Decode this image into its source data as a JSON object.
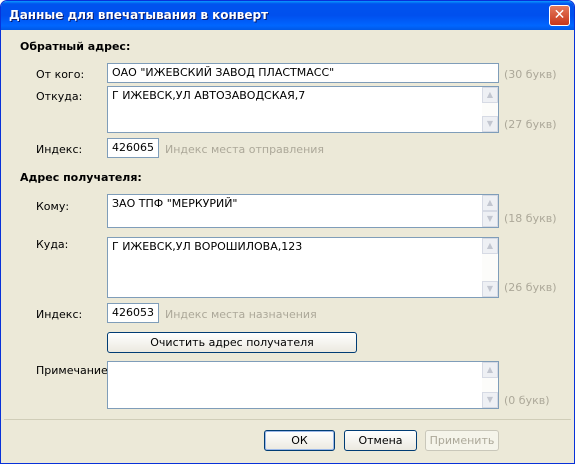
{
  "window": {
    "title": "Данные для впечатывания в конверт",
    "close_glyph": "✕"
  },
  "sender": {
    "section_title": "Обратный адрес:",
    "from_label": "От кого:",
    "from_value": "ОАО \"ИЖЕВСКИЙ ЗАВОД ПЛАСТМАСС\"",
    "from_count": "(30 букв)",
    "where_label": "Откуда:",
    "where_value": "Г ИЖЕВСК,УЛ АВТОЗАВОДСКАЯ,7",
    "where_count": "(27 букв)",
    "index_label": "Индекс:",
    "index_value": "426065",
    "index_hint": "Индекс места отправления"
  },
  "recipient": {
    "section_title": "Адрес получателя:",
    "to_label": "Кому:",
    "to_value": "ЗАО ТПФ \"МЕРКУРИЙ\"",
    "to_count": "(18 букв)",
    "where_label": "Куда:",
    "where_value": "Г ИЖЕВСК,УЛ ВОРОШИЛОВА,123",
    "where_count": "(26 букв)",
    "index_label": "Индекс:",
    "index_value": "426053",
    "index_hint": "Индекс места назначения",
    "clear_button": "Очистить адрес получателя"
  },
  "note": {
    "label": "Примечание:",
    "value": "",
    "count": "(0 букв)"
  },
  "footer": {
    "ok": "ОК",
    "cancel": "Отмена",
    "apply": "Применить"
  },
  "icons": {
    "scroll_up": "▲",
    "scroll_down": "▼"
  },
  "colors": {
    "title_bar": "#0054e3",
    "dialog_bg": "#ece9d8",
    "hint_text": "#aca899",
    "field_border": "#7f9db9"
  }
}
